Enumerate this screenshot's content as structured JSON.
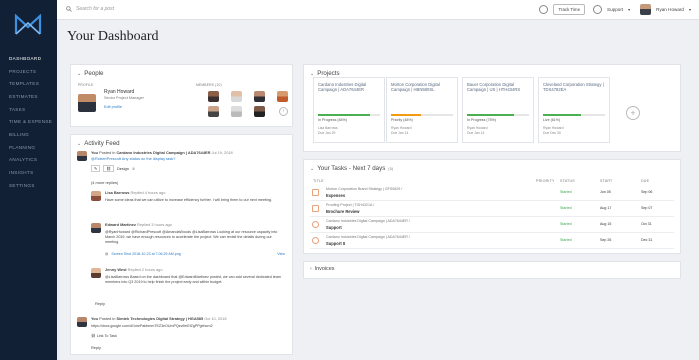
{
  "topbar": {
    "search_placeholder": "Search for a post",
    "track_time": "Track Time",
    "support": "Support",
    "user_name": "Ryan Howard"
  },
  "sidebar": {
    "items": [
      "DASHBOARD",
      "PROJECTS",
      "TEMPLATES",
      "ESTIMATES",
      "TASKS",
      "TIME & EXPENSE",
      "BILLING",
      "PLANNING",
      "ANALYTICS",
      "INSIGHTS",
      "SETTINGS"
    ]
  },
  "page": {
    "title": "Your Dashboard"
  },
  "people": {
    "heading": "People",
    "profile_label": "PROFILE",
    "members_label": "MEMBERS (10)",
    "name": "Ryan Howard",
    "role": "Senior Project Manager",
    "edit": "Edit profile"
  },
  "feed": {
    "heading": "Activity Feed",
    "post1_author": "You",
    "post1_verb": "Posted in",
    "post1_project": "Cardano Industries Digital Campaign | ADA7644ER",
    "post1_date": "Jul 19, 2018",
    "post1_body": "@RobertPrescott Any status on the display task?",
    "design_tag": "Design",
    "replies_link": "(4 more replies)",
    "r1_author": "Lisa Barrows",
    "r1_meta": "Replied 4 hours ago",
    "r1_body": "Have some ideas that we can utilize to increase efficiency further. I will bring them to our next meeting.",
    "r2_author": "Edward Martinez",
    "r2_meta": "Replied 3 hours ago",
    "r2_body": "@RyanHoward @RichardPrescott @AmandaWoods @LisaBarrows Looking at our resource capacity into March 2019, we have enough resources to accelerate the project. We can revisit the details during our meeting.",
    "r2_file": "Screen Shot 2018-10-23 at 7.06.25 AM.png",
    "r2_view": "View",
    "r3_author": "Jenny West",
    "r3_meta": "Replied 2 hours ago",
    "r3_body": "@LisaBarrows Based on the dashboard that @EdwardMartinez posted, we can add several dedicated team members into Q3 2019 to help finish the project early and within budget.",
    "reply1": "Reply",
    "post2_author": "You",
    "post2_verb": "Posted in",
    "post2_project": "Simtek Technologies Digital Strategy | HGA585",
    "post2_date": "Oct 10, 2018",
    "post2_link": "https://docs.google.com/d/1mePabbmmTEZ3eOUmPQsv/fmEfZgPPgbhcrn2",
    "link_task": "Link To Task",
    "reply2": "Reply"
  },
  "projects": {
    "heading": "Projects",
    "cards": [
      {
        "name": "Cardano Industries Digital Campaign | ADA7644ER",
        "status": "In Progress (84%)",
        "owner": "Lisa Barrows",
        "date": "Due Jan 29",
        "progress": 0.84,
        "color": "#4caf50"
      },
      {
        "name": "Morton Corporation Digital Campaign | HBN580SL",
        "status": "Priority (48%)",
        "owner": "Ryan Howard",
        "date": "Due Jan 14",
        "progress": 0.48,
        "color": "#f39c12"
      },
      {
        "name": "Bauer Corporation Digital Campaign | US | HTH434RS",
        "status": "In Progress (75%)",
        "owner": "Ryan Howard",
        "date": "Due Jan 14",
        "progress": 0.75,
        "color": "#4caf50"
      },
      {
        "name": "Cleveland Corporation Strategy | TDS4782EA",
        "status": "Live (61%)",
        "owner": "Ryan Howard",
        "date": "Due Dec 30",
        "progress": 0.61,
        "color": "#4caf50"
      }
    ]
  },
  "tasks": {
    "heading": "Your Tasks - Next 7 days",
    "count": "(5)",
    "cols": {
      "title": "TITLE",
      "priority": "PRIORITY",
      "status": "STATUS",
      "start": "START",
      "due": "DUE"
    },
    "rows": [
      {
        "project": "Morton Corporation Brand Strategy | GFS0629 /",
        "name": "Expenses",
        "status": "Started",
        "start": "Jun 05",
        "due": "Sep 06"
      },
      {
        "project": "Proofing Project | TGH4321A /",
        "name": "Brochure Review",
        "status": "Started",
        "start": "Aug 17",
        "due": "Sep 07"
      },
      {
        "project": "Cardano Industries Digital Campaign | ADA7644ER /",
        "name": "Support",
        "status": "Started",
        "start": "Aug 15",
        "due": "Oct 31"
      },
      {
        "project": "Cardano Industries Digital Campaign | ADA7644ER /",
        "name": "Support II",
        "status": "Started",
        "start": "Sep 26",
        "due": "Dec 31"
      }
    ]
  },
  "invoices": {
    "heading": "Invoices"
  }
}
